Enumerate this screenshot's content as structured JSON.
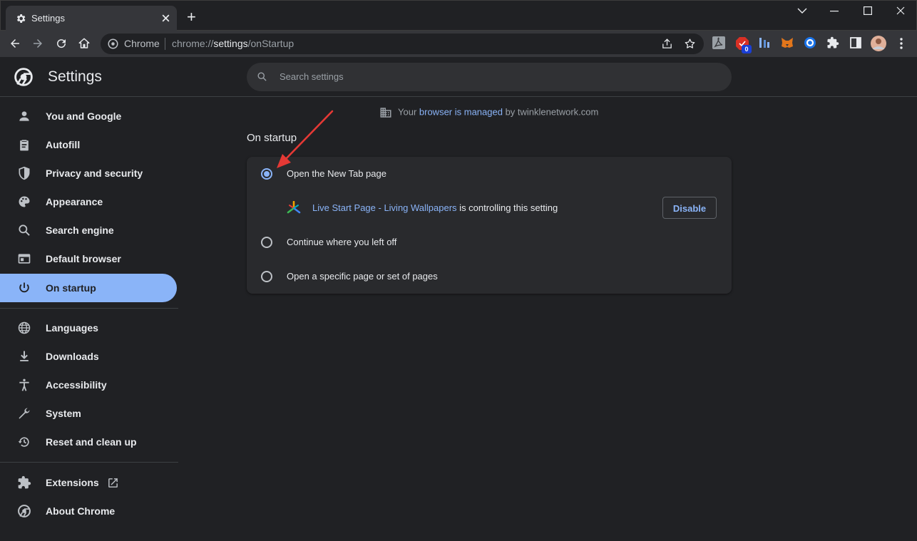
{
  "window": {
    "tab_title": "Settings",
    "new_tab_glyph": "+"
  },
  "omnibox": {
    "site_label": "Chrome",
    "url_scheme": "chrome://",
    "url_host": "settings",
    "url_path": "/onStartup"
  },
  "extensions": {
    "badge_count": "0"
  },
  "header": {
    "title": "Settings",
    "search_placeholder": "Search settings"
  },
  "sidebar": {
    "items": [
      {
        "label": "You and Google",
        "icon": "person-icon"
      },
      {
        "label": "Autofill",
        "icon": "clipboard-icon"
      },
      {
        "label": "Privacy and security",
        "icon": "shield-icon"
      },
      {
        "label": "Appearance",
        "icon": "palette-icon"
      },
      {
        "label": "Search engine",
        "icon": "search-icon"
      },
      {
        "label": "Default browser",
        "icon": "browser-window-icon"
      },
      {
        "label": "On startup",
        "icon": "power-icon",
        "active": true
      },
      {
        "label": "Languages",
        "icon": "globe-icon"
      },
      {
        "label": "Downloads",
        "icon": "download-icon"
      },
      {
        "label": "Accessibility",
        "icon": "accessibility-icon"
      },
      {
        "label": "System",
        "icon": "wrench-icon"
      },
      {
        "label": "Reset and clean up",
        "icon": "history-icon"
      },
      {
        "label": "Extensions",
        "icon": "puzzle-icon"
      },
      {
        "label": "About Chrome",
        "icon": "chrome-logo-icon"
      }
    ]
  },
  "managed_notice": {
    "prefix": "Your ",
    "link": "browser is managed",
    "suffix": " by twinklenetwork.com"
  },
  "startup": {
    "section_title": "On startup",
    "options": [
      {
        "label": "Open the New Tab page",
        "checked": true
      },
      {
        "label": "Continue where you left off",
        "checked": false
      },
      {
        "label": "Open a specific page or set of pages",
        "checked": false
      }
    ],
    "controlling_extension": {
      "name": "Live Start Page - Living Wallpapers",
      "suffix": " is controlling this setting",
      "button_label": "Disable"
    }
  },
  "colors": {
    "accent": "#8ab4f8",
    "background": "#202124",
    "card": "#292a2d",
    "annotation_arrow": "#e53935"
  }
}
